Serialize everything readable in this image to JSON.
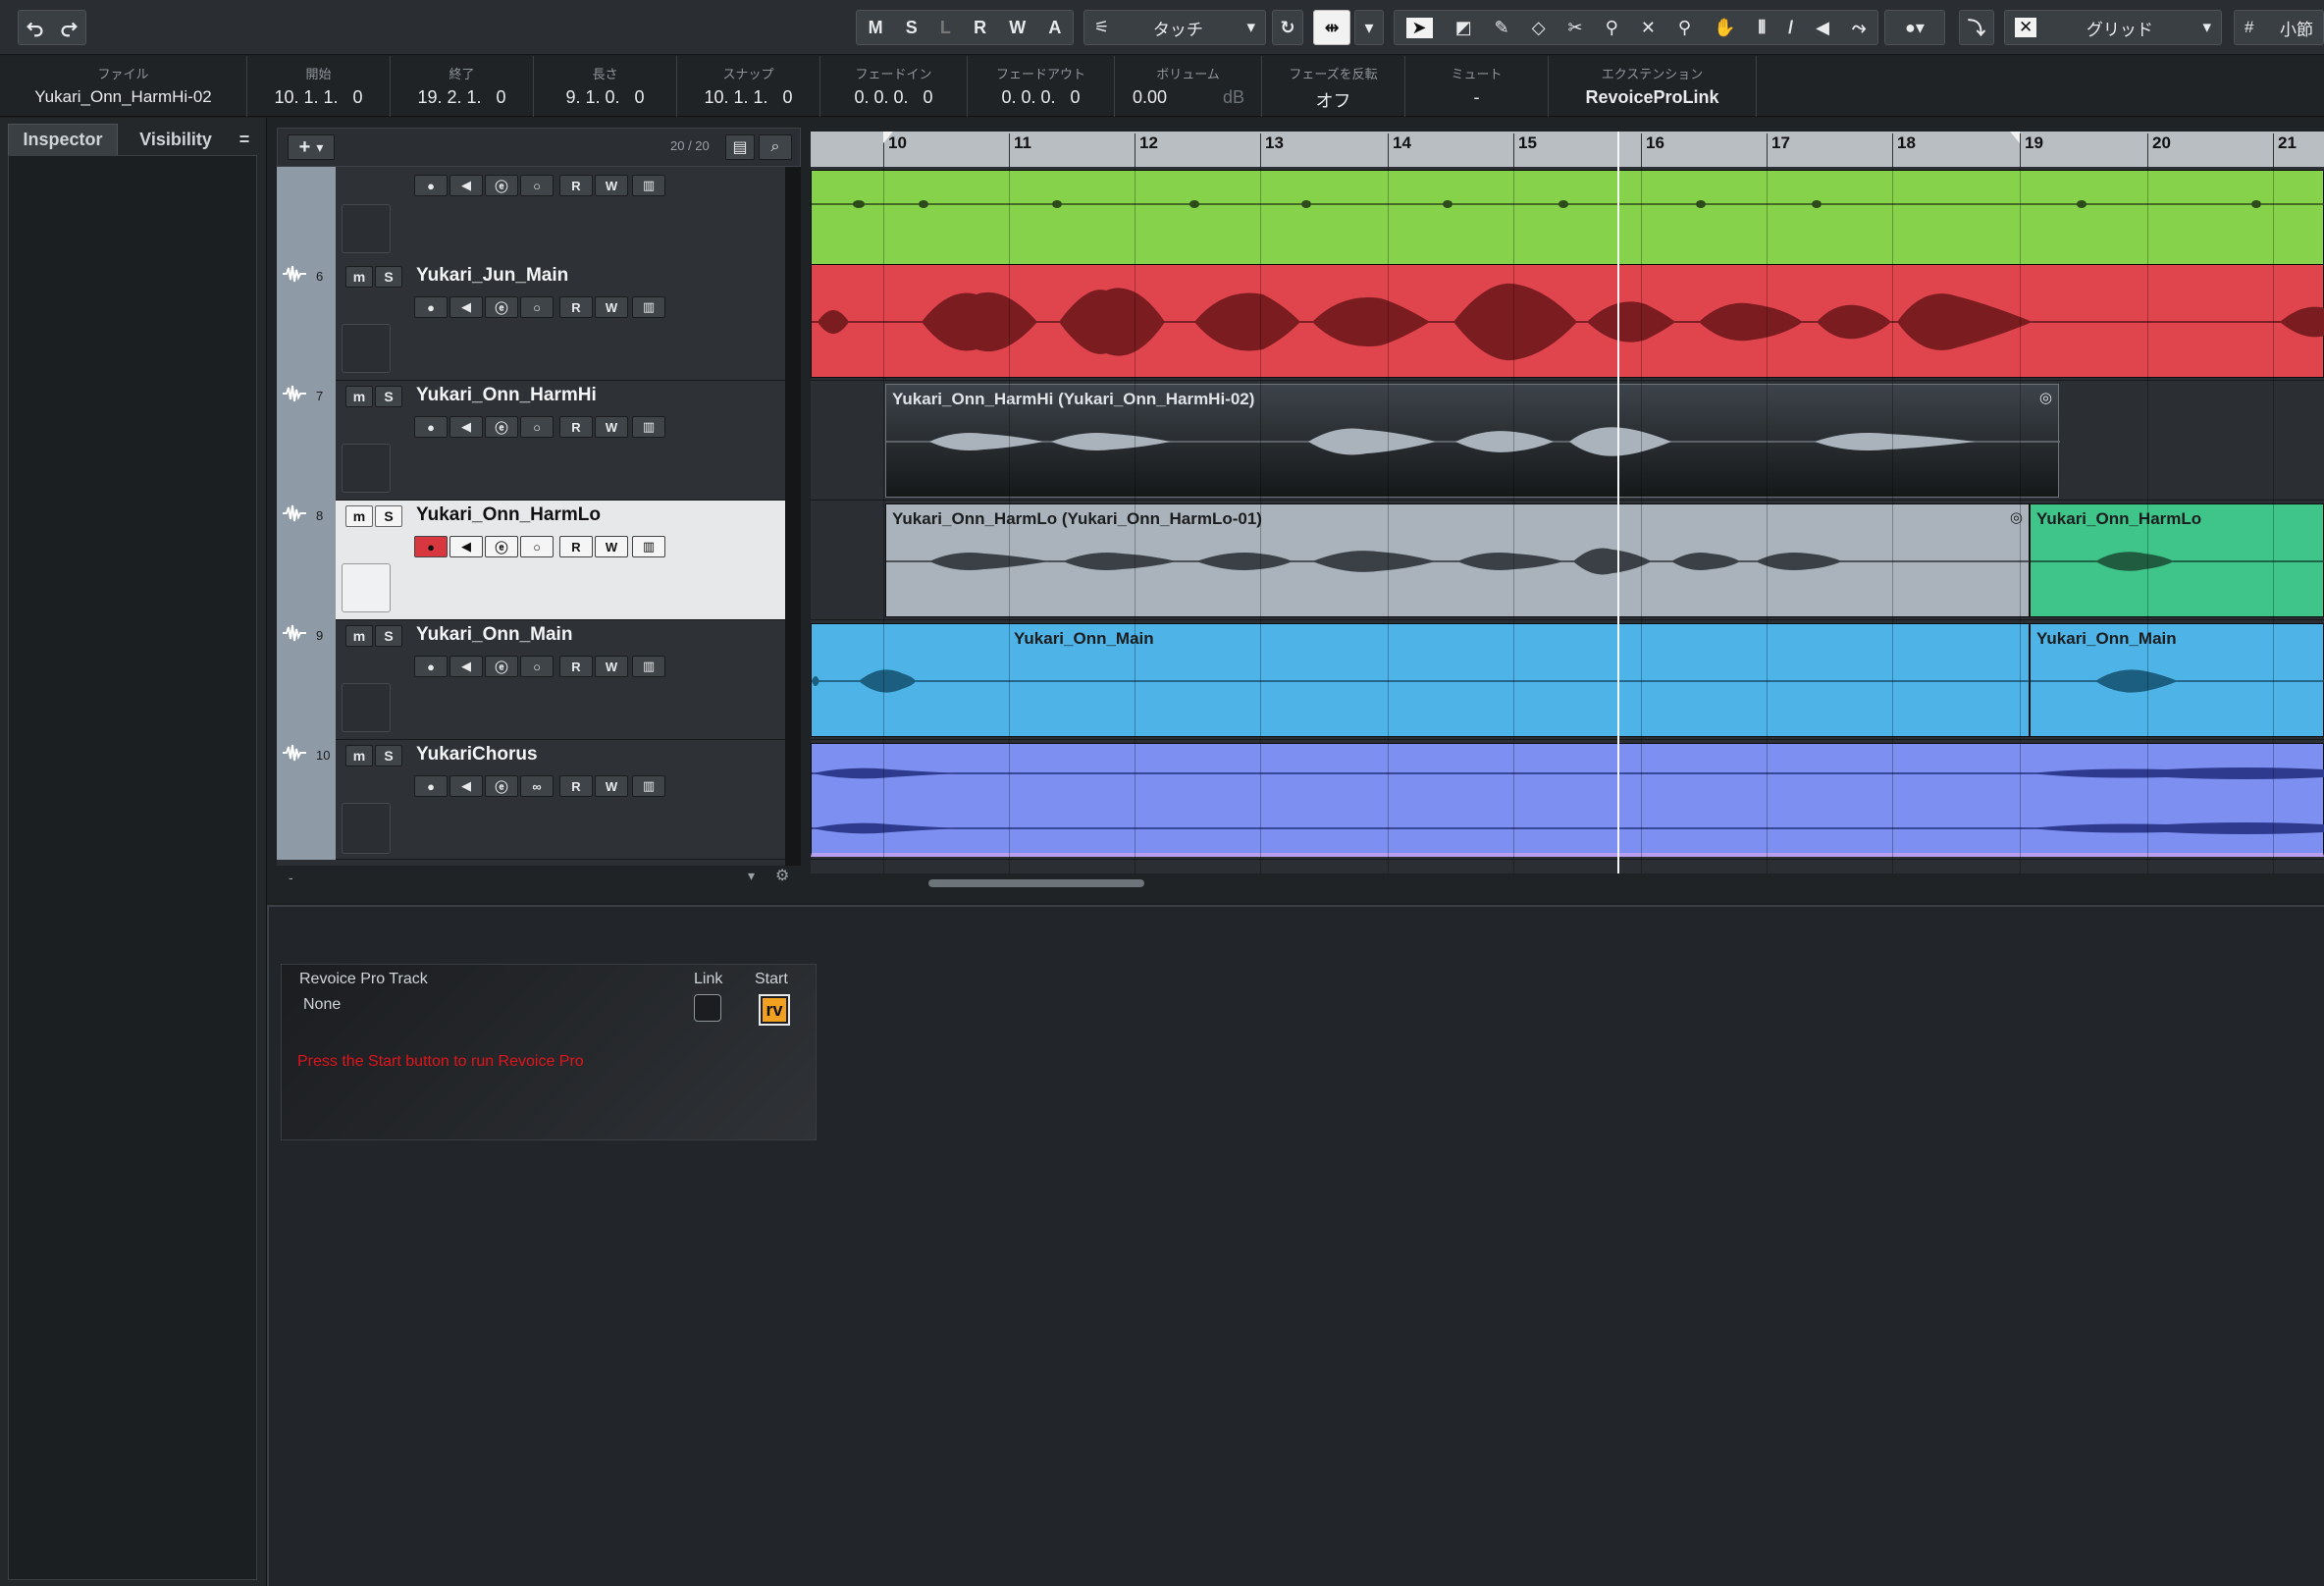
{
  "toolbar": {
    "undo_icon": "undo-icon",
    "redo_icon": "redo-icon",
    "ms_buttons": [
      "M",
      "S",
      "L",
      "R",
      "W",
      "A"
    ],
    "automation_mode": "タッチ",
    "grid_mode": "グリッド",
    "quantize": "小節"
  },
  "infoline": {
    "fields": [
      {
        "label": "ファイル",
        "value": "Yukari_Onn_HarmHi-02"
      },
      {
        "label": "開始",
        "value": "10. 1. 1.   0"
      },
      {
        "label": "終了",
        "value": "19. 2. 1.   0"
      },
      {
        "label": "長さ",
        "value": "9. 1. 0.   0"
      },
      {
        "label": "スナップ",
        "value": "10. 1. 1.   0"
      },
      {
        "label": "フェードイン",
        "value": "0. 0. 0.   0"
      },
      {
        "label": "フェードアウト",
        "value": "0. 0. 0.   0"
      },
      {
        "label": "ボリューム",
        "value": "0.00"
      },
      {
        "label": "フェーズを反転",
        "value": "オフ"
      },
      {
        "label": "ミュート",
        "value": "-"
      },
      {
        "label": "エクステンション",
        "value": "RevoiceProLink"
      }
    ],
    "volume_unit": "dB"
  },
  "inspector": {
    "tab_inspector": "Inspector",
    "tab_visibility": "Visibility",
    "menu_icon": "="
  },
  "tracklist": {
    "add_button": "+",
    "track_count": "20 / 20",
    "collapse_label": "-",
    "tracks": [
      {
        "num": "",
        "name": ""
      },
      {
        "num": "6",
        "name": "Yukari_Jun_Main"
      },
      {
        "num": "7",
        "name": "Yukari_Onn_HarmHi"
      },
      {
        "num": "8",
        "name": "Yukari_Onn_HarmLo"
      },
      {
        "num": "9",
        "name": "Yukari_Onn_Main"
      },
      {
        "num": "10",
        "name": "YukariChorus"
      }
    ],
    "btn_m": "m",
    "btn_s": "S",
    "btn_r": "R",
    "btn_w": "W"
  },
  "ruler": {
    "bars": [
      "10",
      "11",
      "12",
      "13",
      "14",
      "15",
      "16",
      "17",
      "18",
      "19",
      "20",
      "21"
    ]
  },
  "events": {
    "harmhi": "Yukari_Onn_HarmHi (Yukari_Onn_HarmHi-02)",
    "harmlo": "Yukari_Onn_HarmLo (Yukari_Onn_HarmLo-01)",
    "harmlo_b": "Yukari_Onn_HarmLo",
    "main_a": "Yukari_Onn_Main",
    "main_b": "Yukari_Onn_Main"
  },
  "revoice": {
    "track_label": "Revoice Pro Track",
    "track_value": "None",
    "link_label": "Link",
    "start_label": "Start",
    "message": "Press the Start button to run Revoice Pro"
  },
  "colors": {
    "green": "#86d24a",
    "red": "#e0444c",
    "dark": "#24292f",
    "gray": "#aab3bb",
    "teal": "#3fc48a",
    "blue": "#4eb3e6",
    "violet": "#7d8ff0"
  }
}
